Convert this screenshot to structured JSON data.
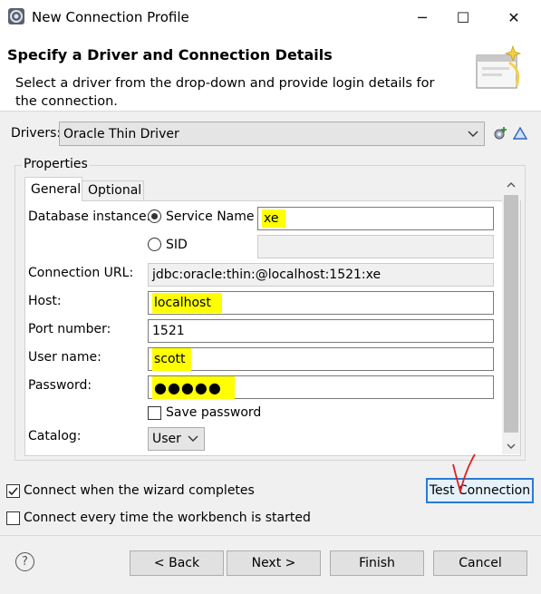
{
  "window": {
    "title": "New Connection Profile",
    "minimize_glyph": "─",
    "maximize_glyph": "☐",
    "close_glyph": "✕"
  },
  "header": {
    "title": "Specify a Driver and Connection Details",
    "description": "Select a driver from the drop-down and provide login details for the connection."
  },
  "drivers": {
    "label": "Drivers:",
    "selected": "Oracle Thin Driver"
  },
  "properties": {
    "group_label": "Properties",
    "tabs": [
      "General",
      "Optional"
    ],
    "active_tab": "General",
    "database_instance_label": "Database instance:",
    "service_name_label": "Service Name",
    "service_name_value": "xe",
    "sid_label": "SID",
    "sid_value": "",
    "connection_url_label": "Connection URL:",
    "connection_url_value": "jdbc:oracle:thin:@localhost:1521:xe",
    "host_label": "Host:",
    "host_value": "localhost",
    "port_label": "Port number:",
    "port_value": "1521",
    "user_label": "User name:",
    "user_value": "scott",
    "password_label": "Password:",
    "password_value": "●●●●●",
    "save_password_label": "Save password",
    "catalog_label": "Catalog:",
    "catalog_value": "User"
  },
  "options": {
    "connect_on_finish_label": "Connect when the wizard completes",
    "connect_on_finish_checked": true,
    "connect_every_time_label": "Connect every time the workbench is started",
    "connect_every_time_checked": false
  },
  "buttons": {
    "test_connection": "Test Connection",
    "back": "< Back",
    "next": "Next >",
    "finish": "Finish",
    "cancel": "Cancel",
    "help": "?"
  },
  "colors": {
    "highlight": "#ffff00",
    "annotation_red": "#e02020",
    "focus_blue": "#2a7ad5"
  }
}
